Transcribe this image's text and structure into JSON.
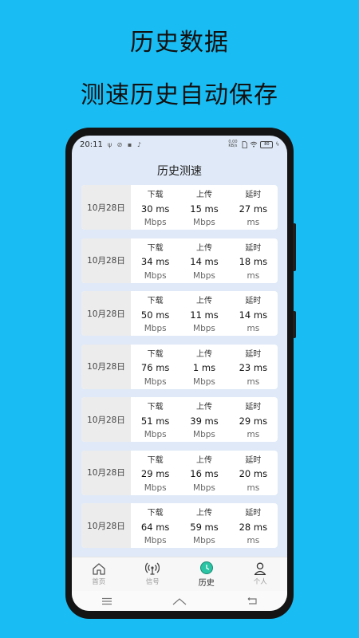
{
  "promo": {
    "headline": "历史数据",
    "subheadline": "测速历史自动保存"
  },
  "status_bar": {
    "time": "20:11",
    "left_icons": "ψ ⊘ ▪ ♪",
    "speed": "0.00 KB/s",
    "battery": "80"
  },
  "screen": {
    "title": "历史测速"
  },
  "records": [
    {
      "date": "10月28日",
      "download_label": "下载",
      "download": "30 ms",
      "download_unit": "Mbps",
      "upload_label": "上传",
      "upload": "15 ms",
      "upload_unit": "Mbps",
      "latency_label": "延时",
      "latency": "27 ms",
      "latency_unit": "ms"
    },
    {
      "date": "10月28日",
      "download_label": "下载",
      "download": "34 ms",
      "download_unit": "Mbps",
      "upload_label": "上传",
      "upload": "14 ms",
      "upload_unit": "Mbps",
      "latency_label": "延时",
      "latency": "18 ms",
      "latency_unit": "ms"
    },
    {
      "date": "10月28日",
      "download_label": "下载",
      "download": "50 ms",
      "download_unit": "Mbps",
      "upload_label": "上传",
      "upload": "11 ms",
      "upload_unit": "Mbps",
      "latency_label": "延时",
      "latency": "14 ms",
      "latency_unit": "ms"
    },
    {
      "date": "10月28日",
      "download_label": "下载",
      "download": "76 ms",
      "download_unit": "Mbps",
      "upload_label": "上传",
      "upload": "1 ms",
      "upload_unit": "Mbps",
      "latency_label": "延时",
      "latency": "23 ms",
      "latency_unit": "ms"
    },
    {
      "date": "10月28日",
      "download_label": "下载",
      "download": "51 ms",
      "download_unit": "Mbps",
      "upload_label": "上传",
      "upload": "39 ms",
      "upload_unit": "Mbps",
      "latency_label": "延时",
      "latency": "29 ms",
      "latency_unit": "ms"
    },
    {
      "date": "10月28日",
      "download_label": "下载",
      "download": "29 ms",
      "download_unit": "Mbps",
      "upload_label": "上传",
      "upload": "16 ms",
      "upload_unit": "Mbps",
      "latency_label": "延时",
      "latency": "20 ms",
      "latency_unit": "ms"
    },
    {
      "date": "10月28日",
      "download_label": "下载",
      "download": "64 ms",
      "download_unit": "Mbps",
      "upload_label": "上传",
      "upload": "59 ms",
      "upload_unit": "Mbps",
      "latency_label": "延时",
      "latency": "28 ms",
      "latency_unit": "ms"
    }
  ],
  "tabs": [
    {
      "label": "首页",
      "icon": "home-icon",
      "active": false
    },
    {
      "label": "信号",
      "icon": "signal-icon",
      "active": false
    },
    {
      "label": "历史",
      "icon": "clock-icon",
      "active": true
    },
    {
      "label": "个人",
      "icon": "person-icon",
      "active": false
    }
  ],
  "nav_buttons": [
    {
      "icon": "menu-icon"
    },
    {
      "icon": "home-nav-icon"
    },
    {
      "icon": "back-icon"
    }
  ],
  "colors": {
    "background": "#19bdf4",
    "active_tab": "#2bc4a4"
  }
}
